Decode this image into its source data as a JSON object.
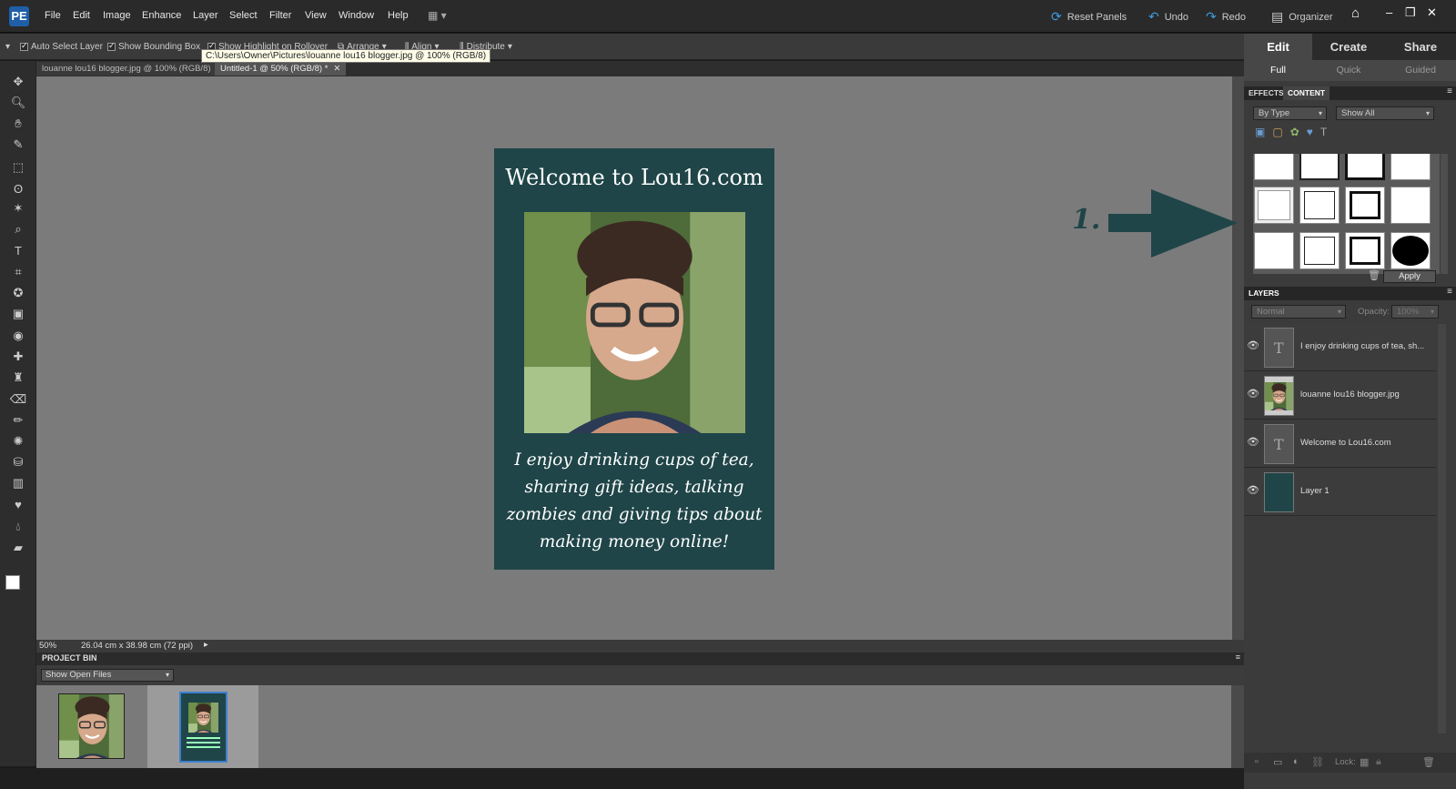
{
  "menubar": {
    "logo": "PE",
    "menus": [
      "File",
      "Edit",
      "Image",
      "Enhance",
      "Layer",
      "Select",
      "Filter",
      "View",
      "Window",
      "Help"
    ],
    "reset_panels": "Reset Panels",
    "undo": "Undo",
    "redo": "Redo",
    "organizer": "Organizer"
  },
  "options": {
    "auto_select": "Auto Select Layer",
    "bounding_box": "Show Bounding Box",
    "highlight": "Show Highlight on Rollover",
    "arrange": "Arrange",
    "align": "Align",
    "distribute": "Distribute"
  },
  "tooltip": "C:\\Users\\Owner\\Pictures\\louanne lou16 blogger.jpg @ 100% (RGB/8)",
  "tabs": [
    {
      "label": "louanne lou16 blogger.jpg @ 100% (RGB/8)"
    },
    {
      "label": "Untitled-1 @ 50% (RGB/8) *"
    }
  ],
  "document": {
    "title": "Welcome to Lou16.com",
    "body": "I enjoy drinking cups of tea, sharing gift ideas, talking zombies and giving tips about making money online!",
    "bg_color": "#1f4548"
  },
  "annotation": {
    "number": "1.",
    "color": "#1f4548"
  },
  "status": {
    "zoom": "50%",
    "dims": "26.04 cm x 38.98 cm (72 ppi)"
  },
  "project_bin": {
    "title": "PROJECT BIN",
    "filter": "Show Open Files"
  },
  "right_panel": {
    "modes": [
      "Edit",
      "Create",
      "Share"
    ],
    "submodes": [
      "Full",
      "Quick",
      "Guided"
    ],
    "effects_tab": "EFFECTS",
    "content_tab": "CONTENT",
    "by_type": "By Type",
    "show_all": "Show All",
    "apply": "Apply",
    "layers_title": "LAYERS",
    "blend_mode": "Normal",
    "opacity_label": "Opacity:",
    "opacity_value": "100%",
    "lock_label": "Lock:",
    "layers": [
      {
        "name": "I enjoy drinking cups of tea, sh...",
        "type": "text"
      },
      {
        "name": "louanne lou16 blogger.jpg",
        "type": "image"
      },
      {
        "name": "Welcome to Lou16.com",
        "type": "text"
      },
      {
        "name": "Layer 1",
        "type": "fill"
      }
    ]
  }
}
